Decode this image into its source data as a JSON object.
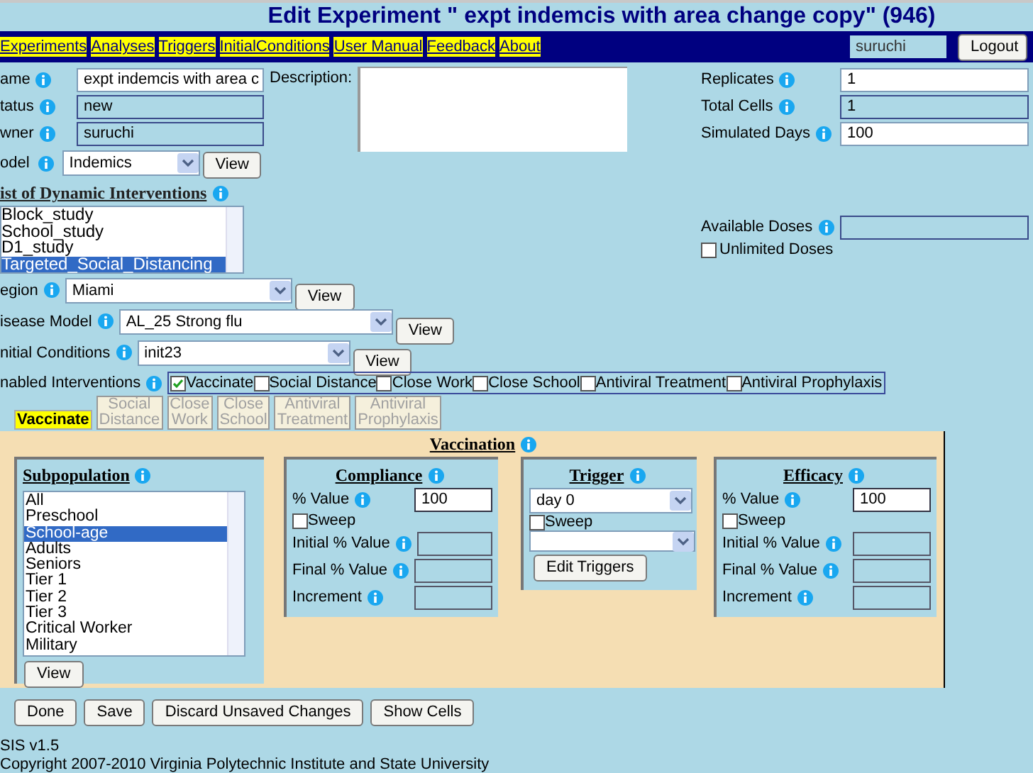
{
  "title": "Edit Experiment \" expt indemcis with area change copy\" (946)",
  "nav_links": [
    "Experiments",
    "Analyses",
    "Triggers",
    "InitialConditions",
    "User Manual",
    "Feedback",
    "About"
  ],
  "user_field": {
    "value": "suruchi"
  },
  "logout_button": "Logout",
  "fields": [
    {
      "label": "ame",
      "value": "expt indemcis with area c",
      "editable": true
    },
    {
      "label": "tatus",
      "value": "new",
      "editable": false
    },
    {
      "label": "wner",
      "value": "suruchi",
      "editable": false
    }
  ],
  "description": {
    "label": "Description:"
  },
  "right_fields": [
    {
      "label": "Replicates",
      "value": "1",
      "editable": true
    },
    {
      "label": "Total Cells",
      "value": "1",
      "editable": false
    },
    {
      "label": "Simulated Days",
      "value": "100",
      "editable": true
    }
  ],
  "model": {
    "label": "odel",
    "value": "Indemics",
    "button": "View"
  },
  "dynamic_interventions": {
    "heading": "ist of Dynamic Interventions",
    "items": [
      {
        "label": "Block_study",
        "selected": false
      },
      {
        "label": "School_study",
        "selected": false
      },
      {
        "label": "D1_study",
        "selected": false
      },
      {
        "label": "Targeted_Social_Distancing",
        "selected": true
      }
    ]
  },
  "available_doses": {
    "label": "Available Doses"
  },
  "unlimited_doses": {
    "label": "Unlimited Doses",
    "checked": false
  },
  "selects": [
    {
      "label": "egion",
      "value": "Miami",
      "button": "View"
    },
    {
      "label": "isease Model",
      "value": "AL_25 Strong flu",
      "button": "View"
    },
    {
      "label": "nitial Conditions",
      "value": "init23",
      "button": "View"
    }
  ],
  "enabled_interventions": {
    "label": "nabled Interventions",
    "items": [
      {
        "label": "Vaccinate",
        "checked": true
      },
      {
        "label": "Social Distance",
        "checked": false
      },
      {
        "label": "Close Work",
        "checked": false
      },
      {
        "label": "Close School",
        "checked": false
      },
      {
        "label": "Antiviral Treatment",
        "checked": false
      },
      {
        "label": "Antiviral Prophylaxis",
        "checked": false
      }
    ]
  },
  "tabs": [
    {
      "lines": [
        "Vaccinate"
      ],
      "selected": true
    },
    {
      "lines": [
        "Social",
        "Distance"
      ],
      "selected": false
    },
    {
      "lines": [
        "Close",
        "Work"
      ],
      "selected": false
    },
    {
      "lines": [
        "Close",
        "School"
      ],
      "selected": false
    },
    {
      "lines": [
        "Antiviral",
        "Treatment"
      ],
      "selected": false
    },
    {
      "lines": [
        "Antiviral",
        "Prophylaxis"
      ],
      "selected": false
    }
  ],
  "section_title": "Vaccination",
  "subpopulation": {
    "heading": "Subpopulation",
    "button": "View",
    "items": [
      {
        "label": "All",
        "selected": false
      },
      {
        "label": "Preschool",
        "selected": false
      },
      {
        "label": "School-age",
        "selected": true
      },
      {
        "label": "Adults",
        "selected": false
      },
      {
        "label": "Seniors",
        "selected": false
      },
      {
        "label": "Tier 1",
        "selected": false
      },
      {
        "label": "Tier 2",
        "selected": false
      },
      {
        "label": "Tier 3",
        "selected": false
      },
      {
        "label": "Critical Worker",
        "selected": false
      },
      {
        "label": "Military",
        "selected": false
      }
    ]
  },
  "compliance": {
    "heading": "Compliance",
    "value_label": "% Value",
    "value": "100",
    "sweep": {
      "label": "Sweep",
      "checked": false
    },
    "rows": [
      "Initial % Value",
      "Final % Value",
      "Increment"
    ]
  },
  "trigger": {
    "heading": "Trigger",
    "select": "day 0",
    "sweep": {
      "label": "Sweep",
      "checked": false
    },
    "button": "Edit Triggers"
  },
  "efficacy": {
    "heading": "Efficacy",
    "value_label": "% Value",
    "value": "100",
    "sweep": {
      "label": "Sweep",
      "checked": false
    },
    "rows": [
      "Initial % Value",
      "Final % Value",
      "Increment"
    ]
  },
  "buttons": [
    "Done",
    "Save",
    "Discard Unsaved Changes",
    "Show Cells"
  ],
  "footer": [
    "SIS v1.5",
    "Copyright 2007-2010 Virginia Polytechnic Institute and State University"
  ]
}
